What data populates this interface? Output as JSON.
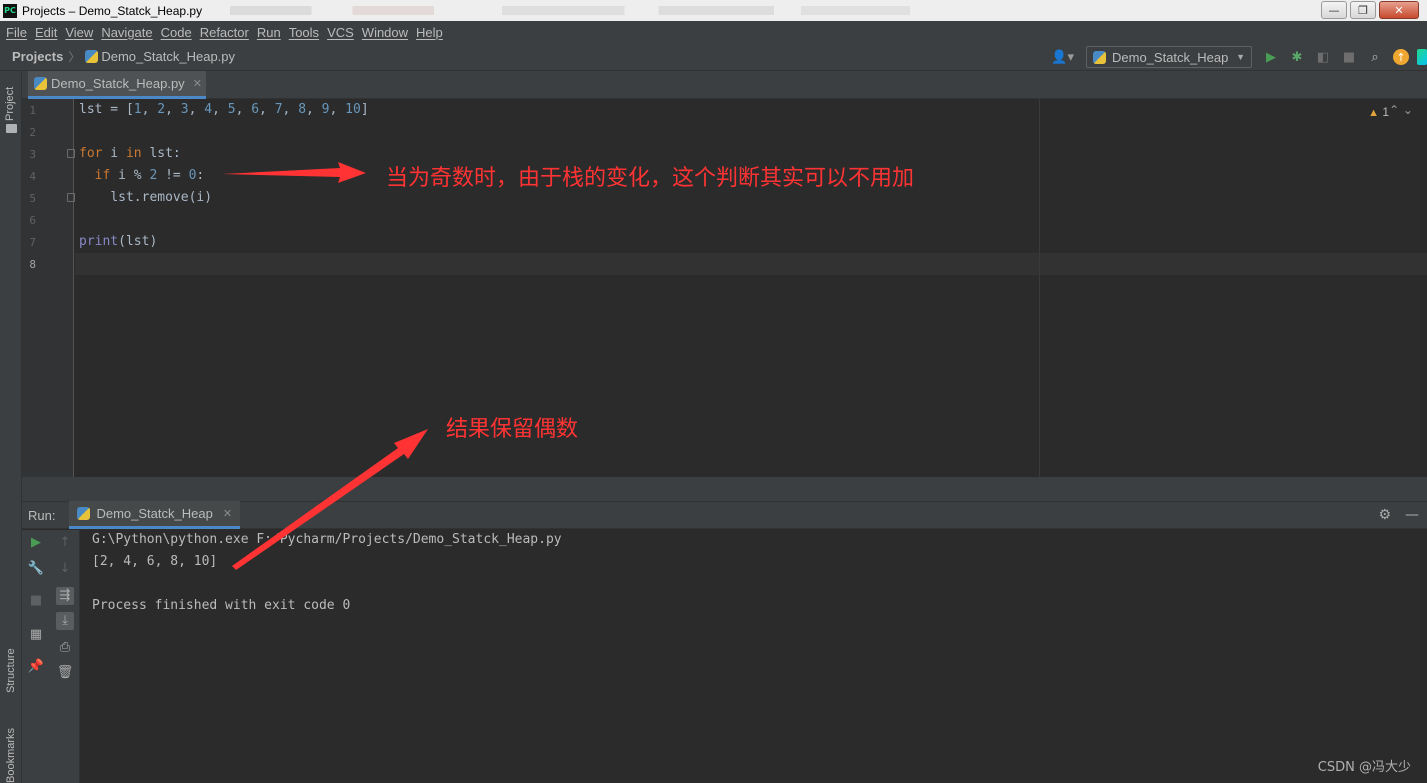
{
  "window": {
    "app_icon": "PC",
    "title": "Projects – Demo_Statck_Heap.py",
    "controls": {
      "minimize": "—",
      "maximize": "❐",
      "close": "✕"
    }
  },
  "menu": [
    "File",
    "Edit",
    "View",
    "Navigate",
    "Code",
    "Refactor",
    "Run",
    "Tools",
    "VCS",
    "Window",
    "Help"
  ],
  "navbar": {
    "root": "Projects",
    "separator": "〉",
    "file": "Demo_Statck_Heap.py",
    "run_config": "Demo_Statck_Heap"
  },
  "left_strip": {
    "project": "Project",
    "structure": "Structure",
    "bookmarks": "Bookmarks"
  },
  "editor": {
    "tab": "Demo_Statck_Heap.py",
    "line_numbers": [
      "1",
      "2",
      "3",
      "4",
      "5",
      "6",
      "7",
      "8"
    ],
    "warning_count": "1",
    "code": {
      "l1_a": "lst = [",
      "l1_nums": [
        "1",
        "2",
        "3",
        "4",
        "5",
        "6",
        "7",
        "8",
        "9",
        "10"
      ],
      "l1_b": "]",
      "l3_for": "for",
      "l3_mid": " i ",
      "l3_in": "in",
      "l3_end": " lst:",
      "l4_if": "if",
      "l4_mid": " i % ",
      "l4_two": "2",
      "l4_neq": " != ",
      "l4_zero": "0",
      "l4_end": ":",
      "l5": "lst.remove(i)",
      "l7_fn": "print",
      "l7_rest": "(lst)"
    }
  },
  "annotations": {
    "top": "当为奇数时，由于栈的变化，这个判断其实可以不用加",
    "bottom": "结果保留偶数",
    "color": "#ff3333"
  },
  "run_panel": {
    "label": "Run:",
    "tab": "Demo_Statck_Heap",
    "output": [
      "G:\\Python\\python.exe F:/Pycharm/Projects/Demo_Statck_Heap.py",
      "[2, 4, 6, 8, 10]",
      "",
      "Process finished with exit code 0"
    ]
  },
  "watermark": "CSDN @冯大少"
}
